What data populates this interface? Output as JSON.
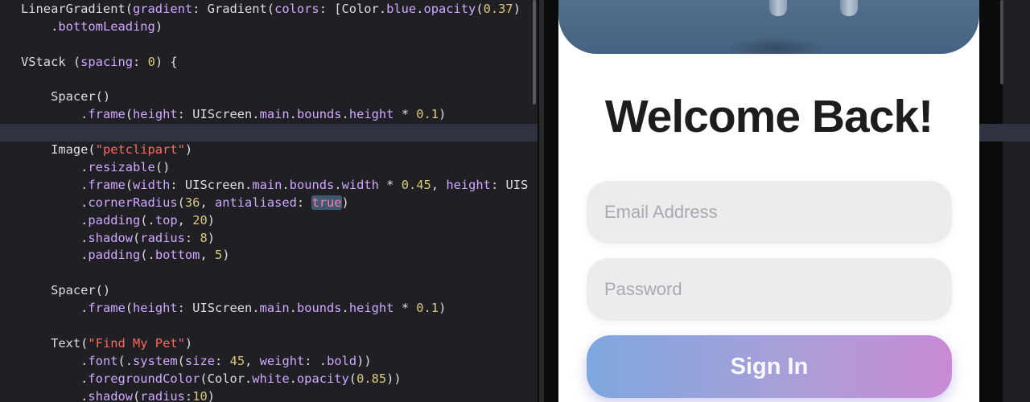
{
  "editor": {
    "lines": [
      [
        {
          "t": "LinearGradient(",
          "c": "type"
        },
        {
          "t": "gradient",
          "c": "param"
        },
        {
          "t": ": Gradient(",
          "c": "type"
        },
        {
          "t": "colors",
          "c": "param"
        },
        {
          "t": ": [Color.",
          "c": "type"
        },
        {
          "t": "blue",
          "c": "member"
        },
        {
          "t": ".",
          "c": "type"
        },
        {
          "t": "opacity",
          "c": "member"
        },
        {
          "t": "(",
          "c": "type"
        },
        {
          "t": "0.37",
          "c": "num"
        },
        {
          "t": ")",
          "c": "type"
        }
      ],
      [
        {
          "t": "    .",
          "c": "type"
        },
        {
          "t": "bottomLeading",
          "c": "member"
        },
        {
          "t": ")",
          "c": "type"
        }
      ],
      [],
      [
        {
          "t": "VStack (",
          "c": "type"
        },
        {
          "t": "spacing",
          "c": "param"
        },
        {
          "t": ": ",
          "c": "type"
        },
        {
          "t": "0",
          "c": "num"
        },
        {
          "t": ") {",
          "c": "type"
        }
      ],
      [],
      [
        {
          "t": "    Spacer()",
          "c": "type"
        }
      ],
      [
        {
          "t": "        .",
          "c": "type"
        },
        {
          "t": "frame",
          "c": "member"
        },
        {
          "t": "(",
          "c": "type"
        },
        {
          "t": "height",
          "c": "param"
        },
        {
          "t": ": UIScreen.",
          "c": "type"
        },
        {
          "t": "main",
          "c": "member"
        },
        {
          "t": ".",
          "c": "type"
        },
        {
          "t": "bounds",
          "c": "member"
        },
        {
          "t": ".",
          "c": "type"
        },
        {
          "t": "height",
          "c": "member"
        },
        {
          "t": " * ",
          "c": "type"
        },
        {
          "t": "0.1",
          "c": "num"
        },
        {
          "t": ")",
          "c": "type"
        }
      ],
      [],
      [
        {
          "t": "    Image(",
          "c": "type"
        },
        {
          "t": "\"petclipart\"",
          "c": "str"
        },
        {
          "t": ")",
          "c": "type"
        }
      ],
      [
        {
          "t": "        .",
          "c": "type"
        },
        {
          "t": "resizable",
          "c": "member"
        },
        {
          "t": "()",
          "c": "type"
        }
      ],
      [
        {
          "t": "        .",
          "c": "type"
        },
        {
          "t": "frame",
          "c": "member"
        },
        {
          "t": "(",
          "c": "type"
        },
        {
          "t": "width",
          "c": "param"
        },
        {
          "t": ": UIScreen.",
          "c": "type"
        },
        {
          "t": "main",
          "c": "member"
        },
        {
          "t": ".",
          "c": "type"
        },
        {
          "t": "bounds",
          "c": "member"
        },
        {
          "t": ".",
          "c": "type"
        },
        {
          "t": "width",
          "c": "member"
        },
        {
          "t": " * ",
          "c": "type"
        },
        {
          "t": "0.45",
          "c": "num"
        },
        {
          "t": ", ",
          "c": "type"
        },
        {
          "t": "height",
          "c": "param"
        },
        {
          "t": ": UIS",
          "c": "type"
        }
      ],
      [
        {
          "t": "        .",
          "c": "type"
        },
        {
          "t": "cornerRadius",
          "c": "member"
        },
        {
          "t": "(",
          "c": "type"
        },
        {
          "t": "36",
          "c": "num"
        },
        {
          "t": ", ",
          "c": "type"
        },
        {
          "t": "antialiased",
          "c": "param"
        },
        {
          "t": ": ",
          "c": "type"
        },
        {
          "t": "true",
          "c": "kw-hl"
        },
        {
          "t": ")",
          "c": "type"
        }
      ],
      [
        {
          "t": "        .",
          "c": "type"
        },
        {
          "t": "padding",
          "c": "member"
        },
        {
          "t": "(.",
          "c": "type"
        },
        {
          "t": "top",
          "c": "member"
        },
        {
          "t": ", ",
          "c": "type"
        },
        {
          "t": "20",
          "c": "num"
        },
        {
          "t": ")",
          "c": "type"
        }
      ],
      [
        {
          "t": "        .",
          "c": "type"
        },
        {
          "t": "shadow",
          "c": "member"
        },
        {
          "t": "(",
          "c": "type"
        },
        {
          "t": "radius",
          "c": "param"
        },
        {
          "t": ": ",
          "c": "type"
        },
        {
          "t": "8",
          "c": "num"
        },
        {
          "t": ")",
          "c": "type"
        }
      ],
      [
        {
          "t": "        .",
          "c": "type"
        },
        {
          "t": "padding",
          "c": "member"
        },
        {
          "t": "(.",
          "c": "type"
        },
        {
          "t": "bottom",
          "c": "member"
        },
        {
          "t": ", ",
          "c": "type"
        },
        {
          "t": "5",
          "c": "num"
        },
        {
          "t": ")",
          "c": "type"
        }
      ],
      [],
      [
        {
          "t": "    Spacer()",
          "c": "type"
        }
      ],
      [
        {
          "t": "        .",
          "c": "type"
        },
        {
          "t": "frame",
          "c": "member"
        },
        {
          "t": "(",
          "c": "type"
        },
        {
          "t": "height",
          "c": "param"
        },
        {
          "t": ": UIScreen.",
          "c": "type"
        },
        {
          "t": "main",
          "c": "member"
        },
        {
          "t": ".",
          "c": "type"
        },
        {
          "t": "bounds",
          "c": "member"
        },
        {
          "t": ".",
          "c": "type"
        },
        {
          "t": "height",
          "c": "member"
        },
        {
          "t": " * ",
          "c": "type"
        },
        {
          "t": "0.1",
          "c": "num"
        },
        {
          "t": ")",
          "c": "type"
        }
      ],
      [],
      [
        {
          "t": "    Text(",
          "c": "type"
        },
        {
          "t": "\"Find My Pet\"",
          "c": "str"
        },
        {
          "t": ")",
          "c": "type"
        }
      ],
      [
        {
          "t": "        .",
          "c": "type"
        },
        {
          "t": "font",
          "c": "member"
        },
        {
          "t": "(.",
          "c": "type"
        },
        {
          "t": "system",
          "c": "member"
        },
        {
          "t": "(",
          "c": "type"
        },
        {
          "t": "size",
          "c": "param"
        },
        {
          "t": ": ",
          "c": "type"
        },
        {
          "t": "45",
          "c": "num"
        },
        {
          "t": ", ",
          "c": "type"
        },
        {
          "t": "weight",
          "c": "param"
        },
        {
          "t": ": .",
          "c": "type"
        },
        {
          "t": "bold",
          "c": "member"
        },
        {
          "t": "))",
          "c": "type"
        }
      ],
      [
        {
          "t": "        .",
          "c": "type"
        },
        {
          "t": "foregroundColor",
          "c": "member"
        },
        {
          "t": "(Color.",
          "c": "type"
        },
        {
          "t": "white",
          "c": "member"
        },
        {
          "t": ".",
          "c": "type"
        },
        {
          "t": "opacity",
          "c": "member"
        },
        {
          "t": "(",
          "c": "type"
        },
        {
          "t": "0.85",
          "c": "num"
        },
        {
          "t": "))",
          "c": "type"
        }
      ],
      [
        {
          "t": "        .",
          "c": "type"
        },
        {
          "t": "shadow",
          "c": "member"
        },
        {
          "t": "(",
          "c": "type"
        },
        {
          "t": "radius",
          "c": "param"
        },
        {
          "t": ":",
          "c": "type"
        },
        {
          "t": "10",
          "c": "num"
        },
        {
          "t": ")",
          "c": "type"
        }
      ]
    ]
  },
  "preview": {
    "heading": "Welcome Back!",
    "email": {
      "value": "",
      "placeholder": "Email Address"
    },
    "password": {
      "value": "",
      "placeholder": "Password"
    },
    "sign_in_label": "Sign In"
  },
  "colors": {
    "editor_background": "#1f1f24",
    "current_line": "#2f3240",
    "string": "#fc6a5d",
    "number": "#d9c97c",
    "member": "#d0a8ff",
    "keyword": "#ff7ab2",
    "button_gradient_start": "#7ea7df",
    "button_gradient_end": "#c98ad6"
  }
}
